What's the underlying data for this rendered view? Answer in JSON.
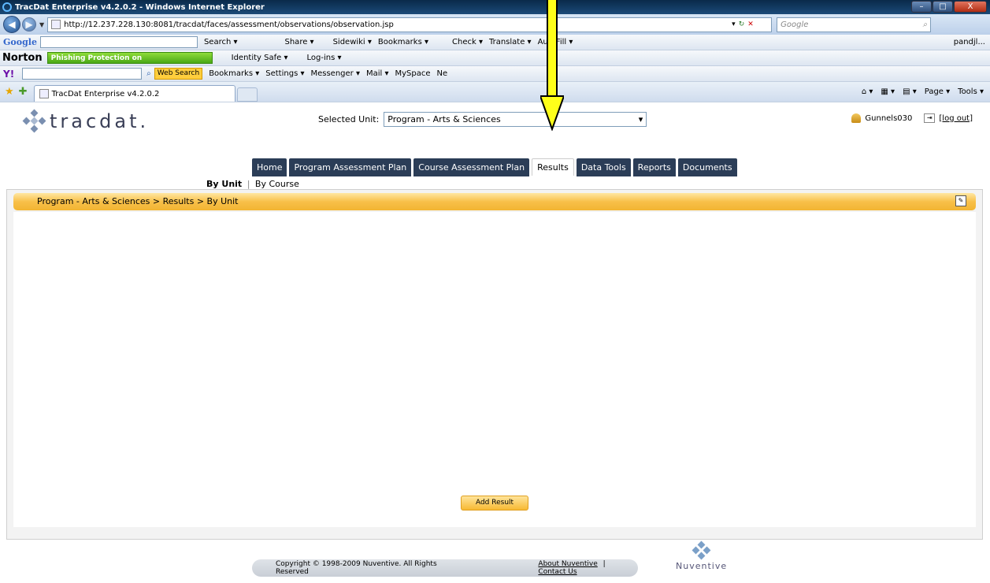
{
  "browser": {
    "window_title": "TracDat Enterprise v4.2.0.2 - Windows Internet Explorer",
    "url": "http://12.237.228.130:8081/tracdat/faces/assessment/observations/observation.jsp",
    "search_placeholder": "Google",
    "tab_title": "TracDat Enterprise v4.2.0.2",
    "min_label": "–",
    "max_label": "□",
    "close_label": "X"
  },
  "google_toolbar": {
    "brand": "Google",
    "items": [
      "Search ▾",
      "Share ▾",
      "Sidewiki ▾",
      "Bookmarks ▾",
      "Check ▾",
      "Translate ▾",
      "AutoFill ▾"
    ],
    "user": "pandjl..."
  },
  "norton_toolbar": {
    "brand": "Norton",
    "phishing": "Phishing Protection on",
    "identity": "Identity Safe ▾",
    "logins": "Log-ins ▾"
  },
  "yahoo_toolbar": {
    "brand": "Y!",
    "web_search": "Web Search",
    "items": [
      "Bookmarks ▾",
      "Settings ▾",
      "Messenger ▾",
      "Mail ▾",
      "MySpace",
      "Ne"
    ]
  },
  "command_bar": {
    "page": "Page ▾",
    "tools": "Tools ▾"
  },
  "app": {
    "logo_text": "tracdat.",
    "selected_unit_label": "Selected Unit:",
    "selected_unit_value": "Program - Arts & Sciences",
    "username": "Gunnels030",
    "logout": "[log out]",
    "nav_tabs": [
      "Home",
      "Program Assessment Plan",
      "Course Assessment Plan",
      "Results",
      "Data Tools",
      "Reports",
      "Documents"
    ],
    "active_tab": "Results",
    "subnav_active": "By Unit",
    "subnav_sep": "|",
    "subnav_other": "By Course",
    "breadcrumb": "Program - Arts & Sciences > Results > By Unit",
    "add_result": "Add Result"
  },
  "footer": {
    "copyright": "Copyright © 1998-2009 Nuventive. All Rights Reserved",
    "about": "About Nuventive",
    "sep": "|",
    "contact": "Contact Us",
    "brand": "Nuventive"
  },
  "colors": {
    "nav_tab": "#2b3d57",
    "panel_header": "#f8c049",
    "arrow": "#ffff1a"
  }
}
